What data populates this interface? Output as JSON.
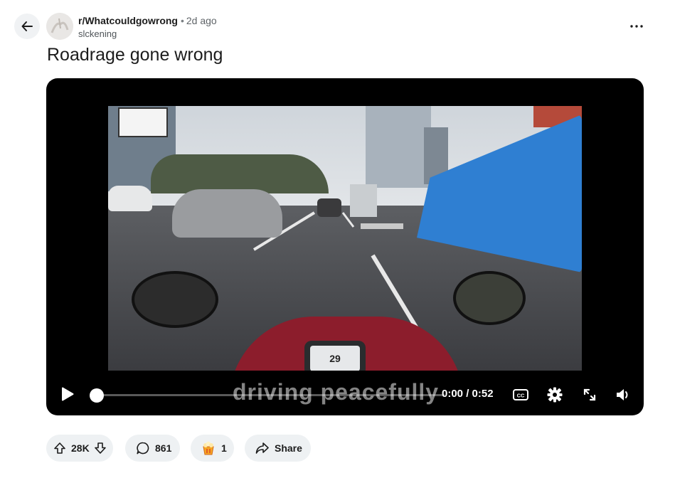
{
  "post": {
    "subreddit": "r/Whatcouldgowrong",
    "separator": "•",
    "age": "2d ago",
    "username": "slckening",
    "title": "Roadrage gone wrong"
  },
  "video": {
    "subtitle": "driving peacefully",
    "current_time": "0:00",
    "duration": "0:52",
    "time_display": "0:00 / 0:52",
    "progress": 0,
    "speedometer": "29"
  },
  "actions": {
    "upvotes": "28K",
    "comments": "861",
    "awards": "1",
    "share_label": "Share"
  },
  "icons": {
    "back": "arrow-left-icon",
    "more": "more-horizontal-icon",
    "upvote": "arrow-up-icon",
    "downvote": "arrow-down-icon",
    "comment": "comment-bubble-icon",
    "award": "award-icon",
    "share": "share-arrow-icon",
    "play": "play-icon",
    "captions": "cc-icon",
    "settings": "gear-icon",
    "fullscreen": "expand-icon",
    "volume": "volume-icon"
  },
  "colors": {
    "pill_bg": "#eef1f3",
    "video_bg": "#000000",
    "text": "#1c1c1c"
  }
}
